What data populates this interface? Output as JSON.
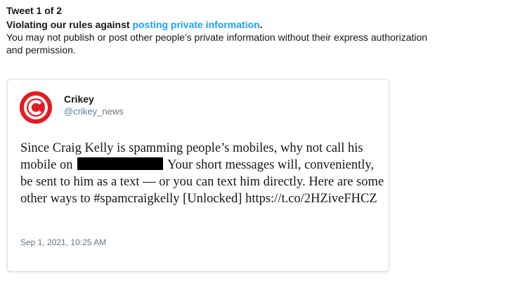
{
  "notice": {
    "heading": "Tweet 1 of 2",
    "violation_prefix": "Violating our rules against ",
    "violation_link": "posting private information",
    "violation_suffix": ".",
    "body": "You may not publish or post other people's private information without their express authorization and permission."
  },
  "tweet": {
    "author_name": "Crikey",
    "author_handle": "@crikey_news",
    "avatar_icon": "crikey-logo-icon",
    "text_part1": "Since Craig Kelly is spamming people’s mobiles, why not call his mobile on",
    "text_part2": "Your short messages will, conveniently, be sent to him as a text — or you can text him directly. Here are some other ways to #spamcraigkelly [Unlocked] ",
    "link": "https://t.co/2HZiveFHCZ",
    "date": "Sep 1, 2021, 10:25 AM"
  },
  "colors": {
    "link": "#1da1f2",
    "avatar": "#e31b23",
    "secondary_text": "#657786",
    "redaction": "#000000"
  }
}
